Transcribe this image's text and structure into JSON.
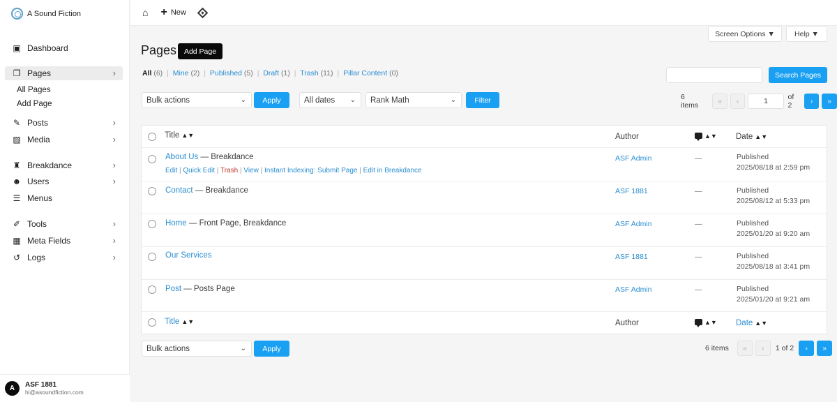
{
  "brand": {
    "name": "A Sound Fiction"
  },
  "sidebar": {
    "items": [
      {
        "label": "Dashboard",
        "icon": "dashboard-icon"
      },
      {
        "label": "Pages",
        "icon": "pages-icon"
      },
      {
        "label": "Posts",
        "icon": "posts-icon"
      },
      {
        "label": "Media",
        "icon": "media-icon"
      },
      {
        "label": "Breakdance",
        "icon": "breakdance-icon"
      },
      {
        "label": "Users",
        "icon": "users-icon"
      },
      {
        "label": "Menus",
        "icon": "menus-icon"
      },
      {
        "label": "Tools",
        "icon": "tools-icon"
      },
      {
        "label": "Meta Fields",
        "icon": "meta-fields-icon"
      },
      {
        "label": "Logs",
        "icon": "logs-icon"
      }
    ],
    "sub_items": [
      "All Pages",
      "Add Page"
    ]
  },
  "user": {
    "initial": "A",
    "name": "ASF 1881",
    "email": "hi@asoundfiction.com"
  },
  "topbar": {
    "new_label": "New"
  },
  "screen_options": {
    "screen": "Screen Options ▼",
    "help": "Help ▼"
  },
  "page": {
    "title": "Pages",
    "add_label": "Add Page"
  },
  "filters": {
    "all": "All",
    "all_count": "(6)",
    "mine": "Mine",
    "mine_count": "(2)",
    "published": "Published",
    "published_count": "(5)",
    "draft": "Draft",
    "draft_count": "(1)",
    "trash": "Trash",
    "trash_count": "(11)",
    "pillar": "Pillar Content",
    "pillar_count": "(0)"
  },
  "search": {
    "button": "Search Pages",
    "placeholder": ""
  },
  "toolbar": {
    "bulk": "Bulk actions",
    "apply": "Apply",
    "dates": "All dates",
    "rank": "Rank Math",
    "filter": "Filter"
  },
  "pagination": {
    "items": "6 items",
    "current": "1",
    "of": "of 2",
    "bottom_of": "1 of 2",
    "first": "«",
    "prev": "‹",
    "next": "›",
    "last": "»"
  },
  "table": {
    "col_title": "Title",
    "col_author": "Author",
    "col_date": "Date",
    "rows": [
      {
        "title": "About Us",
        "state": " — Breakdance",
        "author": "ASF Admin",
        "comments": "—",
        "status": "Published",
        "date": "2025/08/18 at 2:59 pm"
      },
      {
        "title": "Contact",
        "state": " — Breakdance",
        "author": "ASF 1881",
        "comments": "—",
        "status": "Published",
        "date": "2025/08/12 at 5:33 pm"
      },
      {
        "title": "Home",
        "state": " — Front Page, Breakdance",
        "author": "ASF Admin",
        "comments": "—",
        "status": "Published",
        "date": "2025/01/20 at 9:20 am"
      },
      {
        "title": "Our Services",
        "state": "",
        "author": "ASF 1881",
        "comments": "—",
        "status": "Published",
        "date": "2025/08/18 at 3:41 pm"
      },
      {
        "title": "Post",
        "state": " — Posts Page",
        "author": "ASF Admin",
        "comments": "—",
        "status": "Published",
        "date": "2025/01/20 at 9:21 am"
      }
    ],
    "row_actions": {
      "edit": "Edit",
      "quick_edit": "Quick Edit",
      "trash": "Trash",
      "view": "View",
      "indexing": "Instant Indexing: Submit Page",
      "breakdance": "Edit in Breakdance"
    }
  }
}
